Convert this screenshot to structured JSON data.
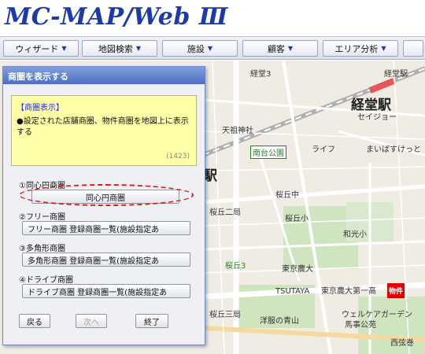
{
  "app": {
    "title": "MC-MAP/Web Ⅲ"
  },
  "menu": [
    {
      "label": "ウィザード"
    },
    {
      "label": "地図検索"
    },
    {
      "label": "施設"
    },
    {
      "label": "顧客"
    },
    {
      "label": "エリア分析"
    }
  ],
  "map": {
    "labels": {
      "kyodo3": "経堂3",
      "kyodo_station_small": "経堂駅",
      "kyodo_station": "経堂駅",
      "seijo": "セイジョー",
      "tenso": "天祖神社",
      "nandai_park": "南台公園",
      "life": "ライフ",
      "maibasket": "まいばすけっと",
      "eki": "駅",
      "sakuragaoka_mid": "桜丘中",
      "sakuragaoka2": "桜丘二局",
      "sakuragaoka_small": "桜丘小",
      "wako": "和光小",
      "sakuragaoka3": "桜丘3",
      "tokyo_nodai": "東京農大",
      "tsutaya": "TSUTAYA",
      "nodai_high": "東京農大第一高",
      "sakuragaoka3_kyoku": "桜丘三局",
      "yofuku": "洋服の青山",
      "welcare": "ウェルケアガーデン",
      "baji_park": "馬事公苑",
      "nishikata": "西弦巻",
      "property_marker": "物件"
    }
  },
  "dialog": {
    "title": "商圏を表示する",
    "notice": {
      "title": "【商圏表示】",
      "text": "●設定された店舗商圏、物件商圏を地図上に表示する",
      "code": "(1423)"
    },
    "sections": [
      {
        "label": "①同心円商圏",
        "buttons": [
          "同心円商圏"
        ]
      },
      {
        "label": "②フリー商圏",
        "buttons": [
          "フリー商圏 登録商圏一覧(施設指定あ"
        ]
      },
      {
        "label": "③多角形商圏",
        "buttons": [
          "多角形商圏 登録商圏一覧(施設指定あ"
        ]
      },
      {
        "label": "④ドライブ商圏",
        "buttons": [
          "ドライブ商圏 登録商圏一覧(施設指定あ"
        ]
      }
    ],
    "footer": {
      "back": "戻る",
      "next": "次へ",
      "finish": "終了"
    }
  },
  "colors": {
    "logo": "#1c3aa8",
    "dialog_title_bar": "#5a7ac8",
    "notice_bg": "#ffffa8",
    "highlight": "#e01818",
    "station_bar": "#e8565a",
    "property_marker": "#e00000"
  }
}
